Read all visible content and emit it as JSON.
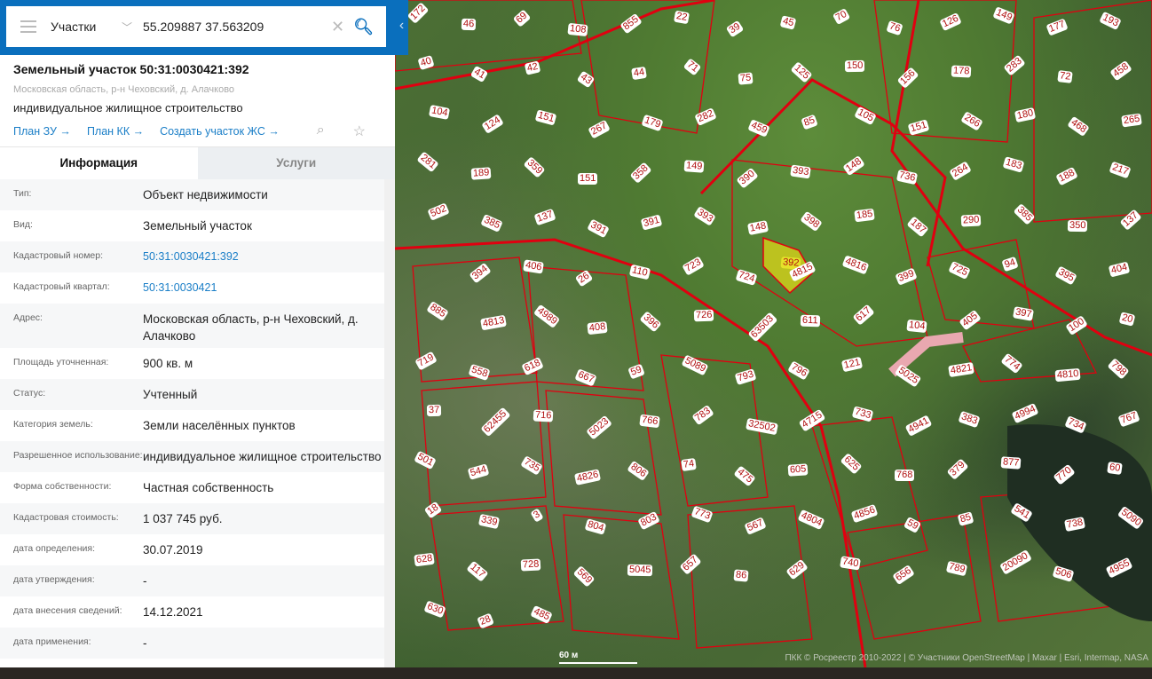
{
  "search": {
    "layer": "Участки",
    "query": "55.209887 37.563209"
  },
  "parcel": {
    "title": "Земельный участок 50:31:0030421:392",
    "address": "Московская область, р-н Чеховский, д. Алачково",
    "use": "индивидуальное жилищное строительство",
    "links": [
      "План ЗУ →",
      "План КК →",
      "Создать участок ЖС →"
    ]
  },
  "tabs": [
    "Информация",
    "Услуги"
  ],
  "rows": [
    {
      "k": "Тип:",
      "v": "Объект недвижимости"
    },
    {
      "k": "Вид:",
      "v": "Земельный участок"
    },
    {
      "k": "Кадастровый номер:",
      "v": "50:31:0030421:392",
      "link": true
    },
    {
      "k": "Кадастровый квартал:",
      "v": "50:31:0030421",
      "link": true
    },
    {
      "k": "Адрес:",
      "v": "Московская область, р-н Чеховский, д. Алачково"
    },
    {
      "k": "Площадь уточненная:",
      "v": "900 кв. м"
    },
    {
      "k": "Статус:",
      "v": "Учтенный"
    },
    {
      "k": "Категория земель:",
      "v": "Земли населённых пунктов"
    },
    {
      "k": "Разрешенное использование:",
      "v": "индивидуальное жилищное строительство"
    },
    {
      "k": "Форма собственности:",
      "v": "Частная собственность"
    },
    {
      "k": "Кадастровая стоимость:",
      "v": "1 037 745 руб."
    },
    {
      "k": "дата определения:",
      "v": "30.07.2019"
    },
    {
      "k": "дата утверждения:",
      "v": "-"
    },
    {
      "k": "дата внесения сведений:",
      "v": "14.12.2021"
    },
    {
      "k": "дата применения:",
      "v": "-"
    }
  ],
  "map": {
    "scale": "60 м",
    "attribution": "ПКК © Росреестр 2010-2022 | © Участники OpenStreetMap | Maxar | Esri, Intermap, NASA",
    "labels": [
      "172",
      "46",
      "69",
      "108",
      "855",
      "22",
      "39",
      "45",
      "70",
      "76",
      "126",
      "149",
      "177",
      "193",
      "40",
      "41",
      "42",
      "43",
      "44",
      "71",
      "75",
      "125",
      "150",
      "156",
      "178",
      "283",
      "72",
      "458",
      "104",
      "124",
      "151",
      "267",
      "179",
      "282",
      "459",
      "85",
      "105",
      "151",
      "266",
      "180",
      "468",
      "265",
      "281",
      "189",
      "359",
      "151",
      "358",
      "149",
      "390",
      "393",
      "148",
      "736",
      "264",
      "183",
      "188",
      "217",
      "502",
      "385",
      "137",
      "391",
      "391",
      "393",
      "148",
      "398",
      "185",
      "187",
      "290",
      "385",
      "350",
      "137",
      "392",
      "394",
      "406",
      "26",
      "110",
      "723",
      "724",
      "4815",
      "4816",
      "399",
      "725",
      "94",
      "395",
      "404",
      "885",
      "4813",
      "4989",
      "408",
      "396",
      "726",
      "63503",
      "611",
      "617",
      "104",
      "405",
      "397",
      "100",
      "20",
      "719",
      "558",
      "618",
      "667",
      "59",
      "5089",
      "793",
      "796",
      "121",
      "5025",
      "4821",
      "774",
      "4810",
      "798",
      "37",
      "62455",
      "716",
      "5023",
      "766",
      "783",
      "32502",
      "4715",
      "733",
      "4941",
      "383",
      "4994",
      "734",
      "767",
      "501",
      "544",
      "735",
      "4826",
      "806",
      "74",
      "475",
      "605",
      "625",
      "768",
      "379",
      "877",
      "770",
      "60",
      "18",
      "339",
      "3",
      "804",
      "803",
      "773",
      "567",
      "4804",
      "4856",
      "59",
      "85",
      "541",
      "738",
      "5090",
      "628",
      "117",
      "728",
      "569",
      "5045",
      "657",
      "86",
      "629",
      "740",
      "656",
      "789",
      "20090",
      "506",
      "4955",
      "630",
      "28",
      "485"
    ],
    "selected": "392"
  }
}
